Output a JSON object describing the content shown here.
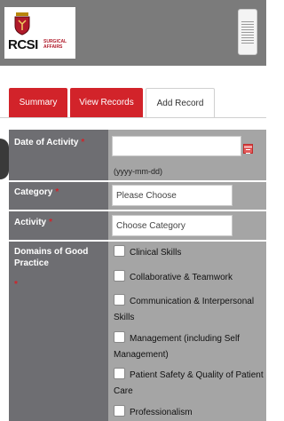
{
  "header": {
    "logo_text": "RCSI",
    "logo_subtext": "SURGICAL AFFAIRS",
    "logo_icon": "crest-icon",
    "menu_icon": "hamburger-icon"
  },
  "tabs": [
    {
      "label": "Summary",
      "active": false
    },
    {
      "label": "View Records",
      "active": false
    },
    {
      "label": "Add Record",
      "active": true
    }
  ],
  "form": {
    "date": {
      "label": "Date of Activity",
      "value": "",
      "hint": "(yyyy-mm-dd)",
      "icon": "calendar-icon"
    },
    "category": {
      "label": "Category",
      "value": "Please Choose"
    },
    "activity": {
      "label": "Activity",
      "value": "Choose Category"
    },
    "domains": {
      "label": "Domains of Good Practice",
      "options": [
        {
          "label": "Clinical Skills",
          "checked": false
        },
        {
          "label": "Collaborative & Teamwork",
          "checked": false
        },
        {
          "label": "Communication & Interpersonal Skills",
          "checked": false
        },
        {
          "label": "Management (including Self Management)",
          "checked": false
        },
        {
          "label": "Patient Safety & Quality of Patient Care",
          "checked": false
        },
        {
          "label": "Professionalism",
          "checked": false
        }
      ]
    },
    "required_marker": "*"
  },
  "colors": {
    "header_bg": "#7b7b7b",
    "brand_red": "#d2232a",
    "label_bg": "#6e6e72",
    "field_bg": "#a5a5a5"
  }
}
